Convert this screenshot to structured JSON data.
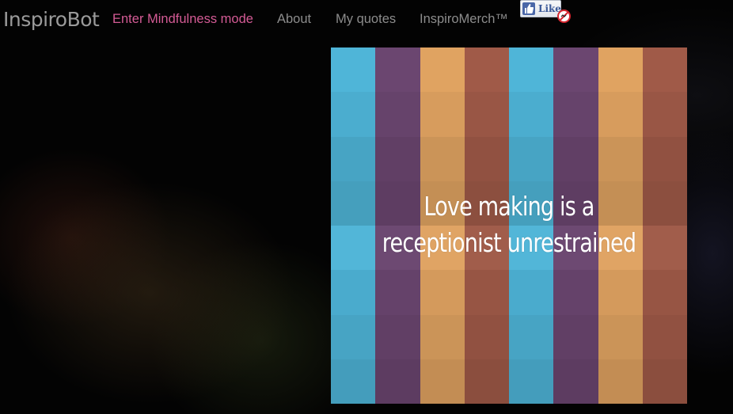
{
  "app": {
    "brand": "InspiroBot"
  },
  "nav": {
    "items": [
      {
        "label": "Enter Mindfulness mode"
      },
      {
        "label": "About"
      },
      {
        "label": "My quotes"
      },
      {
        "label": "InspiroMerch™"
      }
    ]
  },
  "like_button": {
    "label": "Like",
    "icon": "thumbs-up-icon",
    "badge_icon": "blocked-icon"
  },
  "poster": {
    "quote_lines": [
      "Love making is a",
      "receptionist unrestrained"
    ],
    "stripe_colors": [
      "#4fb5d8",
      "#6b4670",
      "#e0a361",
      "#a05a48",
      "#4fb5d8",
      "#6b4670",
      "#e0a361",
      "#a05a48"
    ]
  },
  "colors": {
    "accent_link": "#d45b95",
    "nav_text": "#8c8c8c",
    "background": "#030303"
  }
}
